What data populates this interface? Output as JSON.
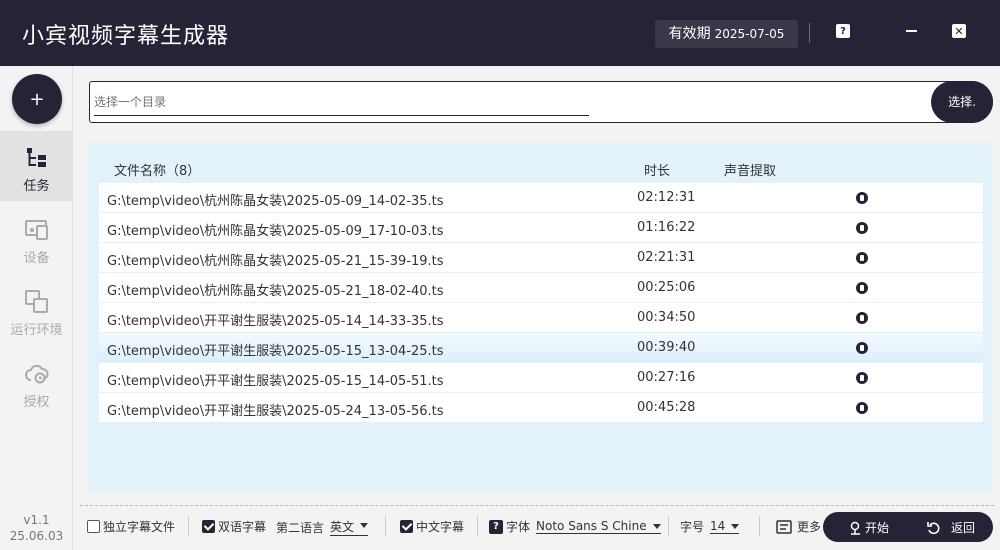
{
  "app": {
    "title": "小宾视频字幕生成器"
  },
  "validity": {
    "label": "有效期",
    "date": "2025-07-05"
  },
  "window_controls": {
    "help": "?"
  },
  "sidebar": {
    "add_label": "+",
    "items": [
      {
        "label": "任务",
        "icon": "task-tree-icon",
        "active": true
      },
      {
        "label": "设备",
        "icon": "device-icon",
        "active": false
      },
      {
        "label": "运行环境",
        "icon": "environment-icon",
        "active": false
      },
      {
        "label": "授权",
        "icon": "cloud-license-icon",
        "active": false
      }
    ],
    "version": "v1.1",
    "build": "25.06.03"
  },
  "path_bar": {
    "placeholder": "选择一个目录",
    "button": "选择."
  },
  "table": {
    "columns": {
      "name": "文件名称（8）",
      "duration": "时长",
      "audio": "声音提取"
    },
    "rows": [
      {
        "path": "G:\\temp\\video\\杭州陈晶女装\\2025-05-09_14-02-35.ts",
        "duration": "02:12:31"
      },
      {
        "path": "G:\\temp\\video\\杭州陈晶女装\\2025-05-09_17-10-03.ts",
        "duration": "01:16:22"
      },
      {
        "path": "G:\\temp\\video\\杭州陈晶女装\\2025-05-21_15-39-19.ts",
        "duration": "02:21:31"
      },
      {
        "path": "G:\\temp\\video\\杭州陈晶女装\\2025-05-21_18-02-40.ts",
        "duration": "00:25:06"
      },
      {
        "path": "G:\\temp\\video\\开平谢生服装\\2025-05-14_14-33-35.ts",
        "duration": "00:34:50"
      },
      {
        "path": "G:\\temp\\video\\开平谢生服装\\2025-05-15_13-04-25.ts",
        "duration": "00:39:40",
        "highlighted": true
      },
      {
        "path": "G:\\temp\\video\\开平谢生服装\\2025-05-15_14-05-51.ts",
        "duration": "00:27:16"
      },
      {
        "path": "G:\\temp\\video\\开平谢生服装\\2025-05-24_13-05-56.ts",
        "duration": "00:45:28"
      }
    ]
  },
  "bottom_bar": {
    "standalone_sub": {
      "label": "独立字幕文件",
      "checked": false
    },
    "bilingual_sub": {
      "label": "双语字幕",
      "checked": true
    },
    "second_lang_label": "第二语言",
    "second_lang_value": "英文",
    "chinese_sub": {
      "label": "中文字幕",
      "checked": true
    },
    "font_help": "?",
    "font_label": "字体",
    "font_value": "Noto Sans S Chine",
    "size_label": "字号",
    "size_value": "14",
    "more_label": "更多",
    "start_label": "开始",
    "back_label": "返回"
  },
  "colors": {
    "primary": "#262336",
    "panel": "#e3f1fb",
    "sidebar_active": "#e2e2e2"
  }
}
